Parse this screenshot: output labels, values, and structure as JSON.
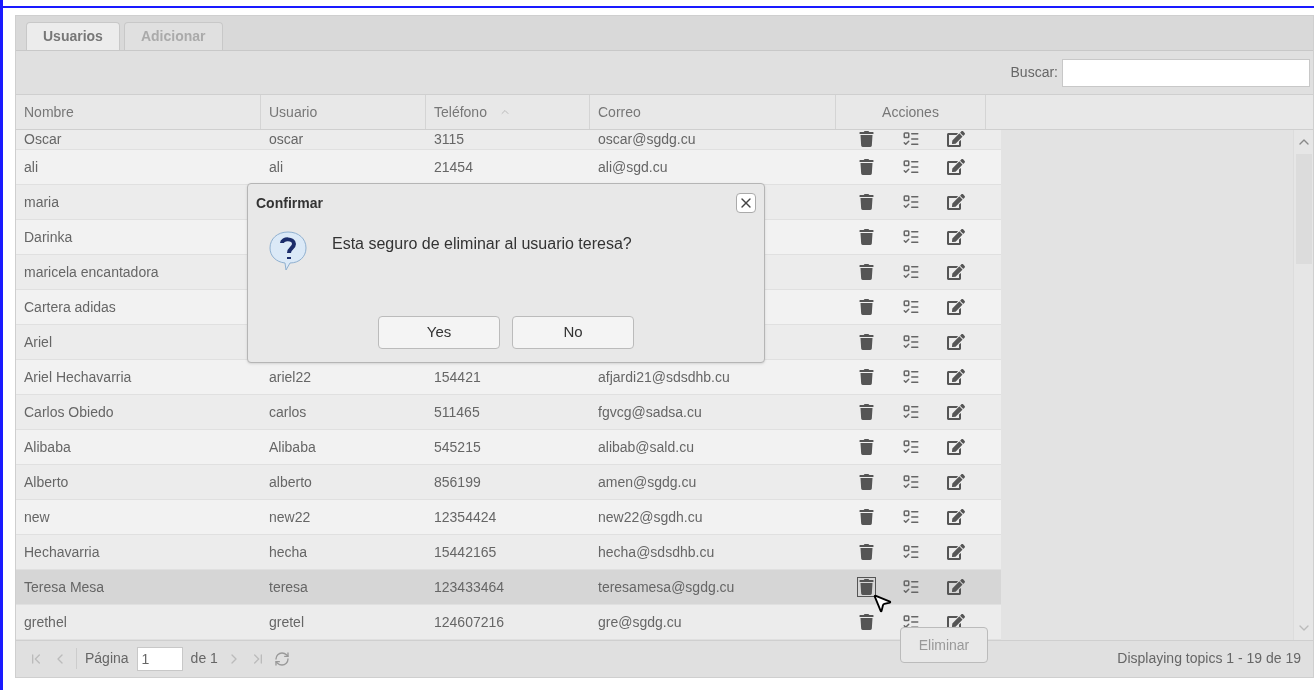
{
  "tabs": [
    {
      "label": "Usuarios",
      "selected": true
    },
    {
      "label": "Adicionar",
      "selected": false
    }
  ],
  "search": {
    "label": "Buscar:"
  },
  "columns": [
    {
      "label": "Nombre",
      "sorted": false
    },
    {
      "label": "Usuario",
      "sorted": false
    },
    {
      "label": "Teléfono",
      "sorted": true
    },
    {
      "label": "Correo",
      "sorted": false
    },
    {
      "label": "Acciones",
      "sorted": false
    }
  ],
  "rows": [
    {
      "nombre": "Oscar",
      "usuario": "oscar",
      "telefono": "3115",
      "correo": "oscar@sgdg.cu",
      "selected": false
    },
    {
      "nombre": "ali",
      "usuario": "ali",
      "telefono": "21454",
      "correo": "ali@sgd.cu",
      "selected": false
    },
    {
      "nombre": "maria",
      "selected": false
    },
    {
      "nombre": "Darinka",
      "selected": false
    },
    {
      "nombre": "maricela encantadora",
      "selected": false
    },
    {
      "nombre": "Cartera adidas",
      "selected": false
    },
    {
      "nombre": "Ariel",
      "selected": false
    },
    {
      "nombre": "Ariel Hechavarria",
      "usuario": "ariel22",
      "telefono": "154421",
      "correo": "afjardi21@sdsdhb.cu",
      "selected": false
    },
    {
      "nombre": "Carlos Obiedo",
      "usuario": "carlos",
      "telefono": "511465",
      "correo": "fgvcg@sadsa.cu",
      "selected": false
    },
    {
      "nombre": "Alibaba",
      "usuario": "Alibaba",
      "telefono": "545215",
      "correo": "alibab@sald.cu",
      "selected": false
    },
    {
      "nombre": "Alberto",
      "usuario": "alberto",
      "telefono": "856199",
      "correo": "amen@sgdg.cu",
      "selected": false
    },
    {
      "nombre": "new",
      "usuario": "new22",
      "telefono": "12354424",
      "correo": "new22@sgdh.cu",
      "selected": false
    },
    {
      "nombre": "Hechavarria",
      "usuario": "hecha",
      "telefono": "15442165",
      "correo": "hecha@sdsdhb.cu",
      "selected": false
    },
    {
      "nombre": "Teresa Mesa",
      "usuario": "teresa",
      "telefono": "123433464",
      "correo": "teresamesa@sgdg.cu",
      "selected": true
    },
    {
      "nombre": "grethel",
      "usuario": "gretel",
      "telefono": "124607216",
      "correo": "gre@sgdg.cu",
      "selected": false
    }
  ],
  "tooltip": "Eliminar",
  "paging": {
    "page_label": "Página",
    "page": "1",
    "of": "de 1",
    "summary": "Displaying topics 1 - 19 de 19"
  },
  "dialog": {
    "title": "Confirmar",
    "message": "Esta seguro de eliminar al usuario teresa?",
    "buttons": [
      "Yes",
      "No"
    ]
  }
}
